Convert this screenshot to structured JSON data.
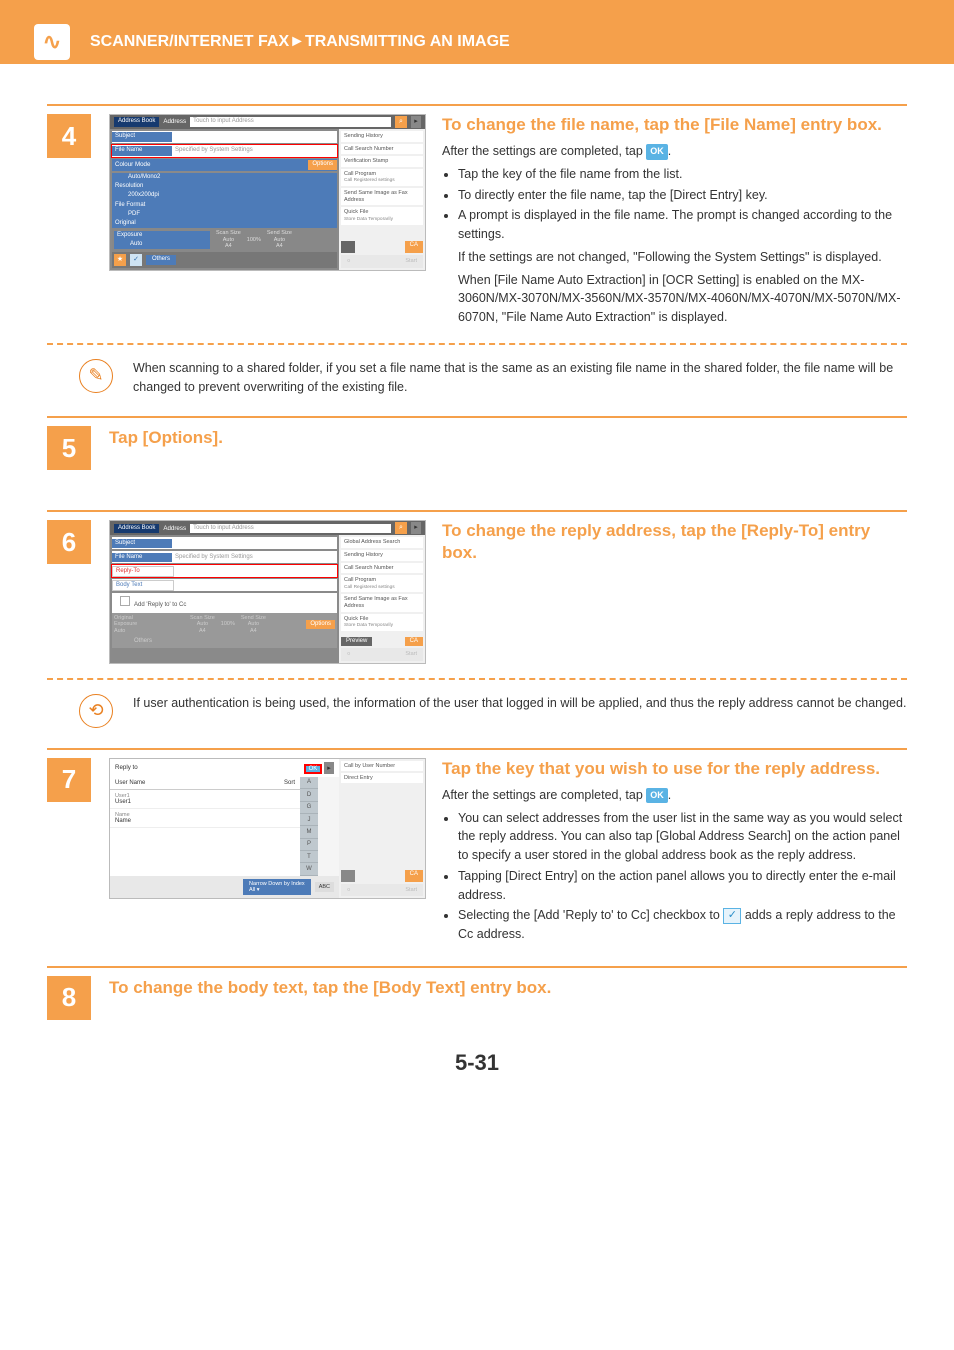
{
  "header": {
    "breadcrumb": "SCANNER/INTERNET FAX►TRANSMITTING AN IMAGE"
  },
  "page_number": "5-31",
  "ok_label": "OK",
  "check_glyph": "✓",
  "steps": {
    "4": {
      "num": "4",
      "title": "To change the file name, tap the [File Name] entry box.",
      "after_line_pre": "After the settings are completed, tap ",
      "after_line_post": ".",
      "bullets": [
        "Tap the key of the file name from the list.",
        "To directly enter the file name, tap the [Direct Entry] key.",
        "A prompt is displayed in the file name. The prompt is changed according to the settings."
      ],
      "para1": "If the settings are not changed, \"Following the System Settings\" is displayed.",
      "para2": "When [File Name Auto Extraction] in [OCR Setting] is enabled on the MX-3060N/MX-3070N/MX-3560N/MX-3570N/MX-4060N/MX-4070N/MX-5070N/MX-6070N, \"File Name Auto Extraction\" is displayed.",
      "note": "When scanning to a shared folder, if you set a file name that is the same as an existing file name in the shared folder, the file name will be changed to prevent overwriting of the existing file.",
      "shot": {
        "address_book": "Address Book",
        "address": "Address",
        "touch": "Touch to input Address",
        "subject": "Subject",
        "file_name": "File Name",
        "specified": "Specified by System Settings",
        "colour_mode": "Colour Mode",
        "colour_val": "Auto/Mono2",
        "resolution": "Resolution",
        "res_val": "200x200dpi",
        "file_format": "File Format",
        "ff_val": "PDF",
        "original": "Original",
        "exposure": "Exposure",
        "exp_val": "Auto",
        "options": "Options",
        "others": "Others",
        "scan_size": "Scan Size",
        "send_size": "Send Size",
        "pct": "100%",
        "auto": "Auto",
        "a4": "A4",
        "right": {
          "sending_history": "Sending History",
          "call_search": "Call Search Number",
          "ver_stamp": "Verification Stamp",
          "call_prog": "Call Program",
          "call_prog_sub": "Call Registered settings",
          "send_same": "Send Same Image as Fax Address",
          "quick_file": "Quick File",
          "quick_sub": "Store Data Temporarily",
          "ca": "CA"
        }
      }
    },
    "5": {
      "num": "5",
      "title": "Tap [Options]."
    },
    "6": {
      "num": "6",
      "title": "To change the reply address, tap the [Reply-To] entry box.",
      "note": "If user authentication is being used, the information of the user that logged in will be applied, and thus the reply address cannot be changed.",
      "shot": {
        "address_book": "Address Book",
        "address": "Address",
        "touch": "Touch to input Address",
        "subject": "Subject",
        "file_name": "File Name",
        "specified": "Specified by System Settings",
        "reply_to": "Reply-To",
        "body_text": "Body Text",
        "add_cc": "Add 'Reply to' to Cc",
        "options": "Options",
        "others": "Others",
        "original": "Original",
        "exposure": "Exposure",
        "auto": "Auto",
        "scan_size": "Scan Size",
        "send_size": "Send Size",
        "pct": "100%",
        "a4": "A4",
        "right": {
          "global": "Global Address Search",
          "sending_history": "Sending History",
          "call_search": "Call Search Number",
          "call_prog": "Call Program",
          "call_prog_sub": "Call Registered settings",
          "send_same": "Send Same Image as Fax Address",
          "quick_file": "Quick File",
          "quick_sub": "Store Data Temporarily",
          "preview": "Preview",
          "ca": "CA"
        }
      }
    },
    "7": {
      "num": "7",
      "title": "Tap the key that you wish to use for the reply address.",
      "after_line_pre": "After the settings are completed, tap ",
      "after_line_post": ".",
      "bullets": [
        "You can select addresses from the user list in the same way as you would select the reply address. You can also tap [Global Address Search] on the action panel to specify a user stored in the global address book as the reply address.",
        "Tapping [Direct Entry] on the action panel allows you to directly enter the e-mail address."
      ],
      "bullet3_pre": "Selecting the [Add 'Reply to' to Cc] checkbox to ",
      "bullet3_post": " adds a reply address to the Cc address.",
      "shot": {
        "reply_to": "Reply to",
        "user_name": "User Name",
        "sort": "Sort",
        "ok": "OK",
        "u1a": "User1",
        "u1b": "User1",
        "u2a": "Name",
        "u2b": "Name",
        "alpha": [
          "A",
          "D",
          "G",
          "J",
          "M",
          "P",
          "T",
          "W"
        ],
        "narrow": "Narrow Down by Index",
        "all": "All",
        "abc": "ABC",
        "right": {
          "call_user": "Call by User Number",
          "direct": "Direct Entry",
          "ca": "CA"
        }
      }
    },
    "8": {
      "num": "8",
      "title": "To change the body text, tap the [Body Text] entry box."
    }
  }
}
